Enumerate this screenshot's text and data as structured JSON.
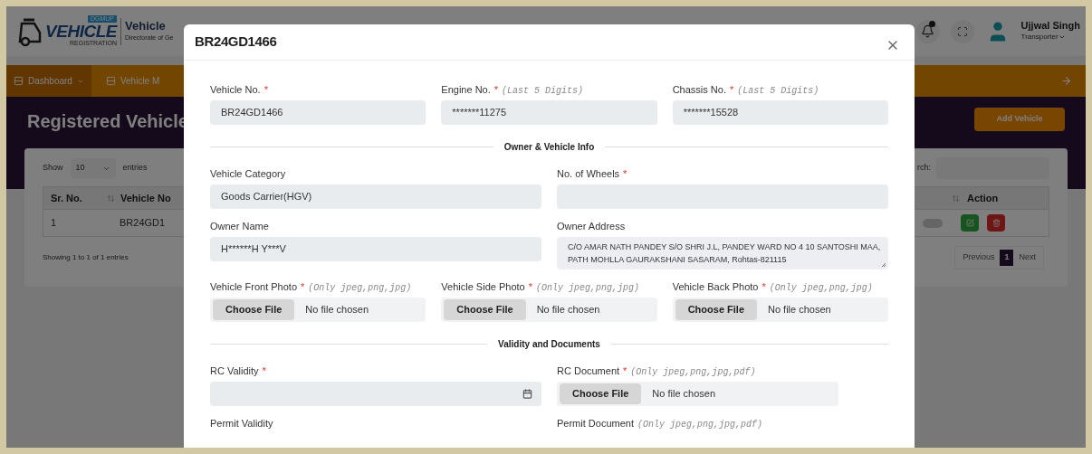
{
  "header": {
    "logo": {
      "badge": "DGMUP",
      "wordmark": "VEHICLE",
      "tagline": "REGISTRATION"
    },
    "title": "Vehicle",
    "subtitle": "Directorate of Ge",
    "user": {
      "name": "Ujjwal Singh",
      "role": "Transporter"
    }
  },
  "nav": [
    {
      "label": "Dashboard",
      "selected": true,
      "caret": true
    },
    {
      "label": "Vehicle M",
      "selected": false,
      "caret": false
    }
  ],
  "page": {
    "title": "Registered Vehicle",
    "add_button": "Add Vehicle"
  },
  "table": {
    "show_label": "Show",
    "page_size": "10",
    "entries_label": "entries",
    "search_label": "rch:",
    "columns": [
      {
        "label": "Sr. No."
      },
      {
        "label": "Vehicle No"
      },
      {
        "label": "Action"
      }
    ],
    "rows": [
      {
        "cells": [
          "1",
          "BR24GD1"
        ],
        "enabled": false
      }
    ],
    "footer": "Showing 1 to 1 of 1 entries",
    "pagination": {
      "previous": "Previous",
      "pages": [
        {
          "label": "1",
          "selected": true
        }
      ],
      "next": "Next"
    }
  },
  "modal": {
    "title": "BR24GD1466",
    "blocks": [
      {
        "kind": "row",
        "fields": [
          {
            "kind": "text",
            "label": "Vehicle No.",
            "mark": "*",
            "value": "BR24GD1466"
          },
          {
            "kind": "text",
            "label": "Engine No.",
            "mark": "*",
            "hint": "(Last 5 Digits)",
            "value": "*******11275"
          },
          {
            "kind": "text",
            "label": "Chassis No.",
            "mark": "*",
            "hint": "(Last 5 Digits)",
            "value": "*******15528"
          }
        ]
      },
      {
        "kind": "section",
        "title": "Owner & Vehicle Info"
      },
      {
        "kind": "row",
        "fields": [
          {
            "kind": "text",
            "label": "Vehicle Category",
            "value": "Goods Carrier(HGV)"
          },
          {
            "kind": "text",
            "label": "No. of Wheels",
            "mark": "*"
          }
        ]
      },
      {
        "kind": "row",
        "fields": [
          {
            "kind": "text",
            "label": "Owner Name",
            "value": "H******H Y***V"
          },
          {
            "kind": "textarea",
            "label": "Owner Address",
            "value": "C/O AMAR NATH PANDEY S/O SHRI J.L, PANDEY WARD NO 4 10 SANTOSHI MAA, PATH MOHLLA GAURAKSHANI SASARAM, Rohtas-821115"
          }
        ]
      },
      {
        "kind": "row",
        "fields": [
          {
            "kind": "file",
            "label": "Vehicle Front Photo",
            "mark": "*",
            "hint": "(Only jpeg,png,jpg)",
            "button": "Choose File",
            "status": "No file chosen"
          },
          {
            "kind": "file",
            "label": "Vehicle Side Photo",
            "mark": "*",
            "hint": "(Only jpeg,png,jpg)",
            "button": "Choose File",
            "status": "No file chosen"
          },
          {
            "kind": "file",
            "label": "Vehicle Back Photo",
            "mark": "*",
            "hint": "(Only jpeg,png,jpg)",
            "button": "Choose File",
            "status": "No file chosen"
          }
        ]
      },
      {
        "kind": "section",
        "title": "Validity and Documents"
      },
      {
        "kind": "row",
        "fields": [
          {
            "kind": "date",
            "label": "RC Validity",
            "mark": "*"
          },
          {
            "kind": "file",
            "label": "RC Document",
            "mark": "*",
            "hint": "(Only jpeg,png,jpg,pdf)",
            "button": "Choose File",
            "status": "No file chosen"
          }
        ]
      },
      {
        "kind": "row",
        "fields": [
          {
            "kind": "label",
            "label": "Permit Validity"
          },
          {
            "kind": "label",
            "label": "Permit Document",
            "hint": "(Only jpeg,png,jpg,pdf)"
          }
        ]
      }
    ]
  }
}
